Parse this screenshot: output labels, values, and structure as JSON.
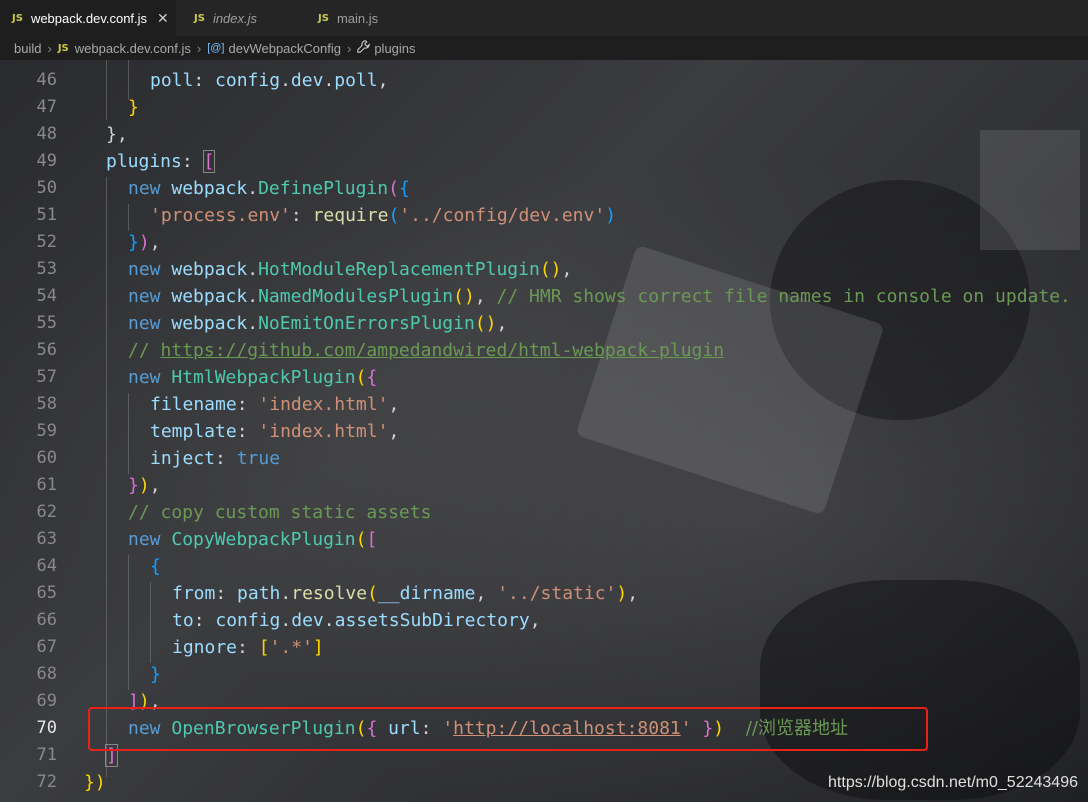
{
  "tabs": [
    {
      "badge": "JS",
      "label": "webpack.dev.conf.js",
      "close": "✕"
    },
    {
      "badge": "JS",
      "label": "index.js"
    },
    {
      "badge": "JS",
      "label": "main.js"
    }
  ],
  "breadcrumbs": {
    "folder": "build",
    "file_badge": "JS",
    "file": "webpack.dev.conf.js",
    "var_icon": "[@]",
    "var": "devWebpackConfig",
    "prop_icon": "wrench-icon",
    "prop": "plugins"
  },
  "lines": [
    {
      "n": "46",
      "t": [
        "poll",
        ": ",
        "config",
        ".",
        "dev",
        ".",
        "poll",
        ","
      ]
    },
    {
      "n": "47",
      "t": [
        "}"
      ]
    },
    {
      "n": "48",
      "t": [
        "},"
      ]
    },
    {
      "n": "49",
      "t": [
        "plugins",
        ": ",
        "["
      ]
    },
    {
      "n": "50",
      "t": [
        "new",
        " ",
        "webpack",
        ".",
        "DefinePlugin",
        "(",
        "{"
      ]
    },
    {
      "n": "51",
      "t": [
        "'process.env'",
        ": ",
        "require",
        "(",
        "'../config/dev.env'",
        ")"
      ]
    },
    {
      "n": "52",
      "t": [
        "}",
        ")",
        ","
      ]
    },
    {
      "n": "53",
      "t": [
        "new",
        " ",
        "webpack",
        ".",
        "HotModuleReplacementPlugin",
        "()",
        ","
      ]
    },
    {
      "n": "54",
      "t": [
        "new",
        " ",
        "webpack",
        ".",
        "NamedModulesPlugin",
        "()",
        ", ",
        "// HMR shows correct file names in console on update."
      ]
    },
    {
      "n": "55",
      "t": [
        "new",
        " ",
        "webpack",
        ".",
        "NoEmitOnErrorsPlugin",
        "()",
        ","
      ]
    },
    {
      "n": "56",
      "t": [
        "// ",
        "https://github.com/ampedandwired/html-webpack-plugin"
      ]
    },
    {
      "n": "57",
      "t": [
        "new",
        " ",
        "HtmlWebpackPlugin",
        "(",
        "{"
      ]
    },
    {
      "n": "58",
      "t": [
        "filename",
        ": ",
        "'index.html'",
        ","
      ]
    },
    {
      "n": "59",
      "t": [
        "template",
        ": ",
        "'index.html'",
        ","
      ]
    },
    {
      "n": "60",
      "t": [
        "inject",
        ": ",
        "true"
      ]
    },
    {
      "n": "61",
      "t": [
        "}",
        ")",
        ","
      ]
    },
    {
      "n": "62",
      "t": [
        "// copy custom static assets"
      ]
    },
    {
      "n": "63",
      "t": [
        "new",
        " ",
        "CopyWebpackPlugin",
        "(",
        "["
      ]
    },
    {
      "n": "64",
      "t": [
        "{"
      ]
    },
    {
      "n": "65",
      "t": [
        "from",
        ": ",
        "path",
        ".",
        "resolve",
        "(",
        "__dirname",
        ", ",
        "'../static'",
        ")",
        ","
      ]
    },
    {
      "n": "66",
      "t": [
        "to",
        ": ",
        "config",
        ".",
        "dev",
        ".",
        "assetsSubDirectory",
        ","
      ]
    },
    {
      "n": "67",
      "t": [
        "ignore",
        ": ",
        "[",
        "'.*'",
        "]"
      ]
    },
    {
      "n": "68",
      "t": [
        "}"
      ]
    },
    {
      "n": "69",
      "t": [
        "]",
        ")",
        ","
      ]
    },
    {
      "n": "70",
      "t": [
        "new",
        " ",
        "OpenBrowserPlugin",
        "(",
        "{",
        " url",
        ": ",
        "'",
        "http://localhost:8081",
        "'",
        " }",
        ")",
        "  ",
        "//浏览器地址"
      ]
    },
    {
      "n": "71",
      "t": [
        "]"
      ]
    },
    {
      "n": "72",
      "t": [
        "})"
      ]
    }
  ],
  "watermark": "https://blog.csdn.net/m0_52243496",
  "colors": {
    "keyword": "#569cd6",
    "property": "#9cdcfe",
    "function": "#dcdcaa",
    "class": "#4ec9b0",
    "string": "#ce9178",
    "comment": "#6a9955",
    "highlight": "#e8211b"
  }
}
